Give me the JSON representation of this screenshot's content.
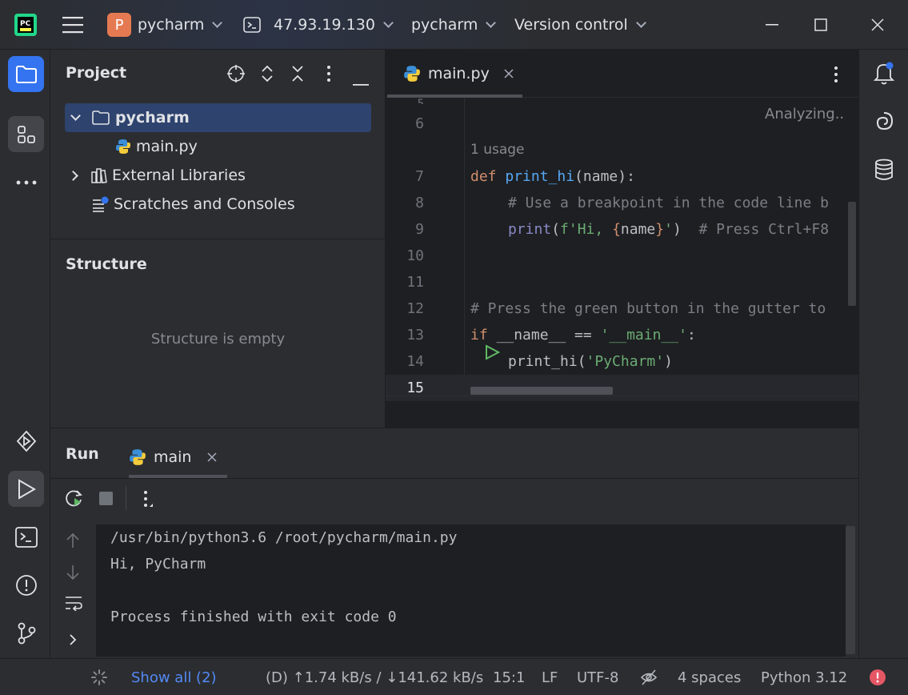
{
  "titlebar": {
    "project_badge": "P",
    "project_name": "pycharm",
    "remote_host": "47.93.19.130",
    "branch_label": "pycharm",
    "vcs_label": "Version control"
  },
  "project_pane": {
    "title": "Project",
    "tree": [
      {
        "label": "pycharm"
      },
      {
        "label": "main.py"
      },
      {
        "label": "External Libraries"
      },
      {
        "label": "Scratches and Consoles"
      }
    ]
  },
  "structure_pane": {
    "title": "Structure",
    "empty_text": "Structure is empty"
  },
  "editor": {
    "tab_label": "main.py",
    "status_text": "Analyzing..",
    "inlay_hint": "1 usage",
    "line_numbers": [
      "6",
      "7",
      "8",
      "9",
      "10",
      "11",
      "12",
      "13",
      "14",
      "15"
    ],
    "lines": {
      "l7_def": "def",
      "l7_fn": "print_hi",
      "l7_rest": "(name):",
      "l8_comment": "# Use a breakpoint in the code line b",
      "l9_print": "print",
      "l9_open": "(",
      "l9_fstr_a": "f'Hi, ",
      "l9_brace_open": "{",
      "l9_name": "name",
      "l9_brace_close": "}",
      "l9_fstr_b": "'",
      "l9_close": ")",
      "l9_comment": "  # Press Ctrl+F8",
      "l12_comment": "# Press the green button in the gutter to",
      "l13_if": "if",
      "l13_mid": " __name__ == ",
      "l13_str": "'__main__'",
      "l13_end": ":",
      "l14_call": "print_hi(",
      "l14_str": "'PyCharm'",
      "l14_end": ")"
    }
  },
  "run_panel": {
    "title": "Run",
    "tab_label": "main",
    "console_lines": [
      "/usr/bin/python3.6 /root/pycharm/main.py",
      "Hi, PyCharm",
      "",
      "Process finished with exit code 0"
    ]
  },
  "statusbar": {
    "show_all": "Show all (2)",
    "network": "(D) ↑1.74 kB/s / ↓141.62 kB/s",
    "position": "15:1",
    "line_sep": "LF",
    "encoding": "UTF-8",
    "indent": "4 spaces",
    "interpreter": "Python 3.12"
  },
  "colors": {
    "accent": "#3574f0",
    "project_badge": "#e57a52",
    "error": "#e55765",
    "run_green": "#5fb865"
  },
  "icons": [
    "pycharm-logo-icon",
    "hamburger-menu-icon",
    "terminal-icon",
    "minimize-icon",
    "maximize-icon",
    "close-icon",
    "folder-icon",
    "structure-icon",
    "more-icon",
    "locate-icon",
    "expand-collapse-icon",
    "collapse-all-icon",
    "options-icon",
    "hide-icon",
    "python-file-icon",
    "library-icon",
    "scratches-icon",
    "run-gutter-icon",
    "notifications-icon",
    "ai-assistant-icon",
    "database-icon",
    "services-icon",
    "run-icon",
    "problems-icon",
    "git-icon",
    "rerun-icon",
    "stop-icon",
    "up-arrow-icon",
    "down-arrow-icon",
    "soft-wrap-icon",
    "expand-icon",
    "progress-icon",
    "no-inspections-icon",
    "error-icon"
  ]
}
